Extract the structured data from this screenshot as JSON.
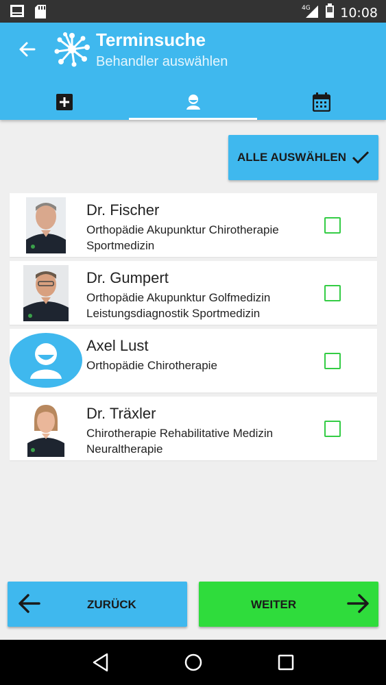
{
  "status_bar": {
    "time": "10:08",
    "network": "4G",
    "icons": [
      "gallery-icon",
      "sd-card-icon",
      "signal-icon",
      "battery-icon"
    ]
  },
  "header": {
    "title": "Terminsuche",
    "subtitle": "Behandler auswählen",
    "back_icon": "arrow-left-icon",
    "logo": "network-logo"
  },
  "tabs": [
    {
      "icon": "add-box-icon",
      "active": false
    },
    {
      "icon": "person-icon",
      "active": true
    },
    {
      "icon": "calendar-icon",
      "active": false
    }
  ],
  "select_all": {
    "label": "ALLE AUSWÄHLEN",
    "icon": "check-icon"
  },
  "practitioners": [
    {
      "name": "Dr. Fischer",
      "specialties": "Orthopädie Akupunktur Chirotherapie Sportmedizin",
      "photo": "photo",
      "checked": false
    },
    {
      "name": "Dr. Gumpert",
      "specialties": "Orthopädie Akupunktur Golfmedizin Leistungsdiagnostik Sportmedizin",
      "photo": "photo",
      "checked": false
    },
    {
      "name": "Axel Lust",
      "specialties": "Orthopädie Chirotherapie",
      "photo": "placeholder",
      "checked": false
    },
    {
      "name": "Dr. Träxler",
      "specialties": "Chirotherapie Rehabilitative Medizin Neuraltherapie",
      "photo": "photo",
      "checked": false
    }
  ],
  "actions": {
    "back_label": "ZURÜCK",
    "next_label": "WEITER"
  },
  "colors": {
    "primary": "#3fb8ee",
    "accent_green": "#2fdc3c",
    "checkbox": "#33cc44",
    "statusbar": "#333333"
  },
  "system_nav": [
    "back-triangle-icon",
    "home-circle-icon",
    "recents-square-icon"
  ]
}
